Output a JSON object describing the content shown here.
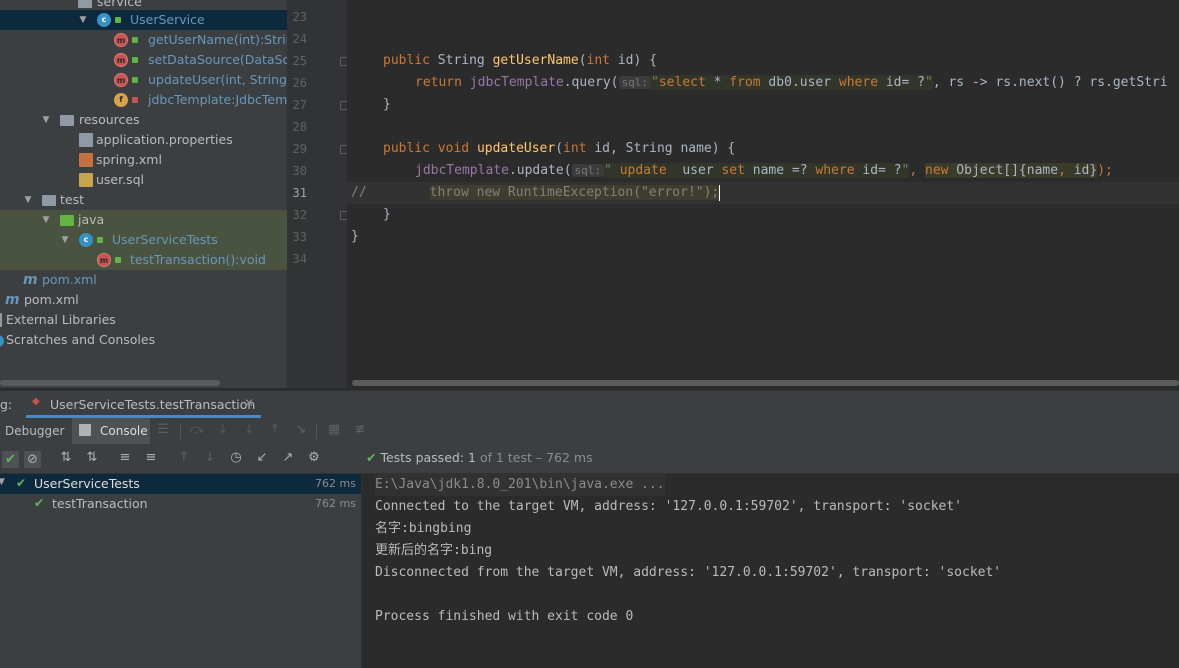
{
  "project_tree": {
    "items": [
      {
        "label": "service",
        "icon": "folder-icon",
        "type": "folder"
      },
      {
        "label": "UserService",
        "icon": "class-icon",
        "type": "class"
      },
      {
        "label": "getUserName(int):String",
        "icon": "method-icon",
        "type": "method"
      },
      {
        "label": "setDataSource(DataSou",
        "icon": "method-icon",
        "type": "method"
      },
      {
        "label": "updateUser(int, String):v",
        "icon": "method-icon",
        "type": "method"
      },
      {
        "label": "jdbcTemplate:JdbcTemp",
        "icon": "field-icon",
        "type": "field"
      },
      {
        "label": "resources",
        "icon": "folder-icon",
        "type": "folder"
      },
      {
        "label": "application.properties",
        "icon": "properties-file-icon",
        "type": "file"
      },
      {
        "label": "spring.xml",
        "icon": "xml-file-icon",
        "type": "file"
      },
      {
        "label": "user.sql",
        "icon": "sql-file-icon",
        "type": "file"
      },
      {
        "label": "test",
        "icon": "folder-icon",
        "type": "folder"
      },
      {
        "label": "java",
        "icon": "folder-icon",
        "type": "folder"
      },
      {
        "label": "UserServiceTests",
        "icon": "class-icon",
        "type": "class"
      },
      {
        "label": "testTransaction():void",
        "icon": "method-icon",
        "type": "method"
      },
      {
        "label": "pom.xml",
        "icon": "maven-icon",
        "type": "file"
      },
      {
        "label": "pom.xml",
        "icon": "maven-icon",
        "type": "file"
      },
      {
        "label": "External Libraries",
        "icon": "libraries-icon",
        "type": "node"
      },
      {
        "label": "Scratches and Consoles",
        "icon": "scratches-icon",
        "type": "node"
      }
    ]
  },
  "editor": {
    "current_line": "31",
    "lines": [
      {
        "num": "23"
      },
      {
        "num": "24"
      },
      {
        "num": "25",
        "t1": "public",
        "t2": " String ",
        "t3": "getUserName",
        "t4": "(",
        "t5": "int",
        "t6": " id) {"
      },
      {
        "num": "26",
        "t1": "return",
        "t2": "jdbcTemplate",
        "t3": ".query(",
        "hint": "sql:",
        "s1": "\"",
        "s2": "select",
        "s3": " * ",
        "s4": "from",
        "s5": " db0.user ",
        "s6": "where",
        "s7": " id= ?",
        "s8": "\"",
        "t4": ", rs -> rs.next() ? rs.getStri"
      },
      {
        "num": "27",
        "t1": "}"
      },
      {
        "num": "28"
      },
      {
        "num": "29",
        "t1": "public",
        "t2": "void",
        "t3": "updateUser",
        "t4": "(",
        "t5": "int",
        "t6": " id, String name) {"
      },
      {
        "num": "30",
        "t1": "jdbcTemplate",
        "t2": ".update(",
        "hint": "sql:",
        "s1": "\" ",
        "s2": "update",
        "s3": "  user ",
        "s4": "set",
        "s5": " name =? ",
        "s6": "where",
        "s7": " id= ?",
        "s8": "\"",
        "t3": ", ",
        "t4": "new",
        "t5": " Object[]{name",
        "t6": ",",
        "t7": " id}",
        "t8": ");"
      },
      {
        "num": "31",
        "t1": "//",
        "t2": "throw new RuntimeException(\"error!\");"
      },
      {
        "num": "32",
        "t1": "}"
      },
      {
        "num": "33",
        "t1": "}"
      },
      {
        "num": "34"
      }
    ]
  },
  "run_panel": {
    "tab_prefix": "g:",
    "tab_label": "UserServiceTests.testTransaction",
    "debugger_label": "Debugger",
    "console_label": "Console",
    "status_prefix": "Tests passed: ",
    "status_count": "1",
    "status_suffix": "of 1 test – 762 ms",
    "results": [
      {
        "label": "UserServiceTests",
        "time": "762 ms"
      },
      {
        "label": "testTransaction",
        "time": "762 ms"
      }
    ],
    "console": [
      "E:\\Java\\jdk1.8.0_201\\bin\\java.exe ...",
      "Connected to the target VM, address: '127.0.0.1:59702', transport: 'socket'",
      "名字:bingbing",
      "更新后的名字:bing",
      "Disconnected from the target VM, address: '127.0.0.1:59702', transport: 'socket'",
      "",
      "Process finished with exit code 0"
    ]
  },
  "colors": {
    "keyword": "#cc7832",
    "method": "#ffc66d",
    "field": "#9876aa",
    "string": "#6a8759",
    "pass": "#5fb85b"
  }
}
